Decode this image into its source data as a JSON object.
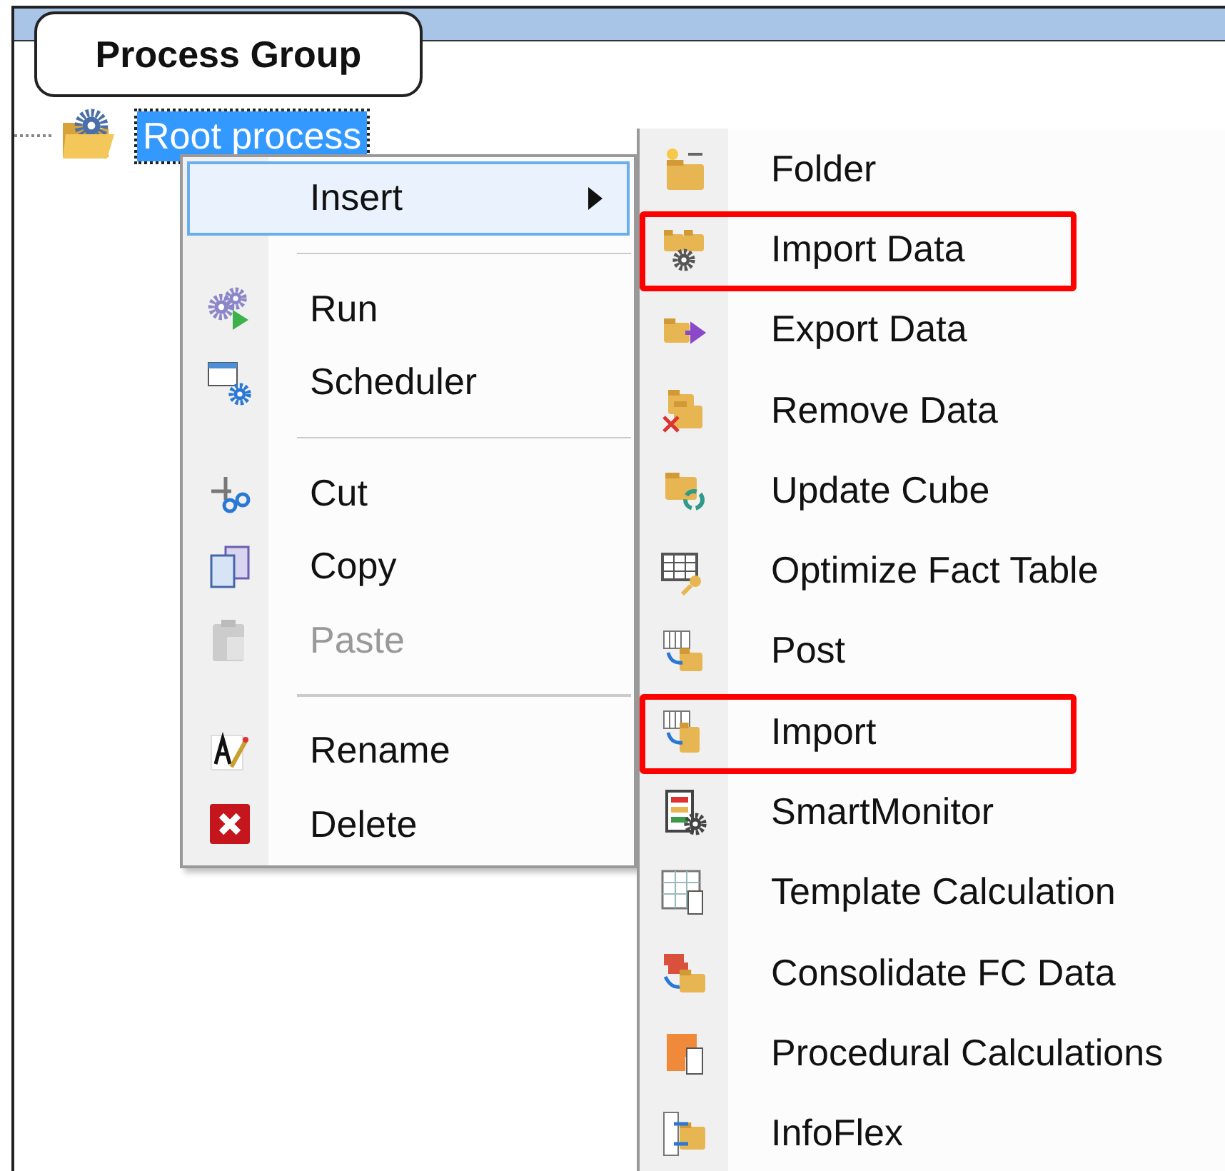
{
  "tab": {
    "label": "Process Group",
    "selected": true
  },
  "tree": [
    {
      "label": "Root process",
      "selected": true
    }
  ],
  "context_menu": [
    {
      "kind": "item",
      "label": "Insert",
      "selected": true,
      "disabled": false,
      "submenu": true
    },
    {
      "kind": "separator"
    },
    {
      "kind": "item",
      "label": "Run",
      "selected": false,
      "disabled": false,
      "submenu": false
    },
    {
      "kind": "item",
      "label": "Scheduler",
      "selected": false,
      "disabled": false,
      "submenu": false
    },
    {
      "kind": "separator"
    },
    {
      "kind": "item",
      "label": "Cut",
      "selected": false,
      "disabled": false,
      "submenu": false
    },
    {
      "kind": "item",
      "label": "Copy",
      "selected": false,
      "disabled": false,
      "submenu": false
    },
    {
      "kind": "item",
      "label": "Paste",
      "selected": false,
      "disabled": true,
      "submenu": false
    },
    {
      "kind": "separator"
    },
    {
      "kind": "item",
      "label": "Rename",
      "selected": false,
      "disabled": false,
      "submenu": false
    },
    {
      "kind": "item",
      "label": "Delete",
      "selected": false,
      "disabled": false,
      "submenu": false
    }
  ],
  "submenu": [
    {
      "label": "Folder",
      "outlined": false
    },
    {
      "label": "Import Data",
      "outlined": true
    },
    {
      "label": "Export Data",
      "outlined": false
    },
    {
      "label": "Remove Data",
      "outlined": false
    },
    {
      "label": "Update Cube",
      "outlined": false
    },
    {
      "label": "Optimize Fact Table",
      "outlined": false
    },
    {
      "label": "Post",
      "outlined": false
    },
    {
      "label": "Import",
      "outlined": true
    },
    {
      "label": "SmartMonitor",
      "outlined": false
    },
    {
      "label": "Template Calculation",
      "outlined": false
    },
    {
      "label": "Consolidate FC Data",
      "outlined": false
    },
    {
      "label": "Procedural Calculations",
      "outlined": false
    },
    {
      "label": "InfoFlex",
      "outlined": false
    }
  ]
}
